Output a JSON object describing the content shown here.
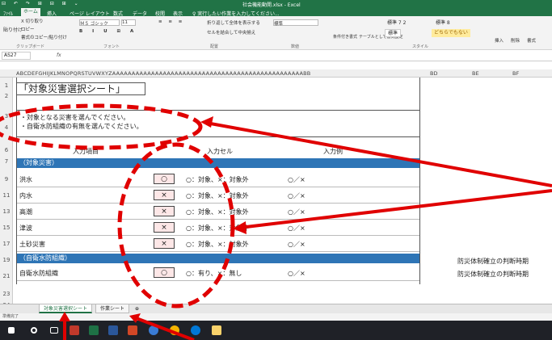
{
  "window": {
    "title": "社会機能動開.xlsx - Excel",
    "quick_access": "⊟ ↶ ↷ ⊞ ⊟ ⊞ ⌄"
  },
  "ribbon_tabs": [
    "ﾌｧｲﾙ",
    "ホーム",
    "挿入",
    "ページ レイアウト",
    "数式",
    "データ",
    "校閲",
    "表示",
    "♀ 実行したい作業を入力してください..."
  ],
  "ribbon": {
    "clipboard": "クリップボード",
    "paste": "貼り付け",
    "cut": "X 切り取り",
    "copy": "コピー",
    "format_painter": "書式のコピー/貼り付け",
    "font_name": "ＭＳ ゴシック",
    "font_size": "11",
    "font_group": "フォント",
    "wrap": "折り返して全体を表示する",
    "merge": "セルを結合して中央揃え",
    "align_group": "配置",
    "number_format": "標準",
    "number_group": "数値",
    "cond_format": "条件付き書式",
    "table_format": "テーブルとして書式設定",
    "style_normal": "標準 7 2",
    "style_normal2": "標準 8",
    "style_standard": "標準",
    "style_neutral": "どちらでもない",
    "styles_group": "スタイル",
    "insert": "挿入",
    "delete": "削除",
    "format": "書式",
    "cells_group": "セル"
  },
  "formula_bar": {
    "name_box": "AS27",
    "fx": "fx"
  },
  "column_headers": "ABCDEFGHIJKLMNOPQRSTUVWXYZAAAAAAAAAAAAAAAAAAAAAAAAAAAAAAAAAAAAAAAAAAAAAAAAABB",
  "col_bd": "BD",
  "col_be": "BE",
  "col_bf": "BF",
  "rows": [
    "1",
    "2",
    "3",
    "4",
    "6",
    "7",
    "9",
    "11",
    "13",
    "15",
    "17",
    "19",
    "21",
    "23",
    "24"
  ],
  "sheet": {
    "title": "「対象災害選択シート」",
    "desc1": "・対象となる災害を選んでください。",
    "desc2": "・自衛水防組織の有無を選んでください。",
    "hdr_item": "入力項目",
    "hdr_cell": "入力セル",
    "hdr_example": "入力例",
    "sec1": "（対象災害）",
    "sec2": "（自衛水防組織）",
    "items": [
      {
        "label": "洪水",
        "value": "○",
        "hint": "○：対象、×：対象外",
        "example": "○／×"
      },
      {
        "label": "内水",
        "value": "×",
        "hint": "○：対象、×：対象外",
        "example": "○／×"
      },
      {
        "label": "高潮",
        "value": "×",
        "hint": "○：対象、×：対象外",
        "example": "○／×"
      },
      {
        "label": "津波",
        "value": "×",
        "hint": "○：対象、×：対象外",
        "example": "○／×"
      },
      {
        "label": "土砂災害",
        "value": "×",
        "hint": "○：対象、×：対象外",
        "example": "○／×"
      }
    ],
    "org": {
      "label": "自衛水防組織",
      "value": "○",
      "hint": "○：有り、×：無し",
      "example": "○／×"
    },
    "side1": "防災体制確立の判断時期",
    "side2": "防災体制確立の判断時期"
  },
  "sheet_tabs": [
    "対象災害選択シート",
    "作業シート",
    "⊕"
  ],
  "status": "準備完了",
  "taskbar_icons": [
    "windows",
    "search",
    "taskview",
    "excel-x",
    "excel",
    "word",
    "powerpoint",
    "edge",
    "chrome",
    "explorer"
  ]
}
